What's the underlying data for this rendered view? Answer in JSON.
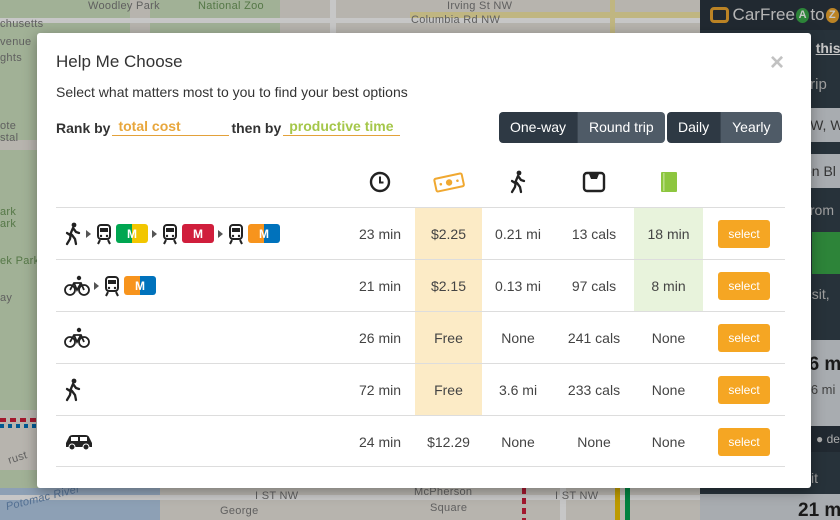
{
  "map": {
    "labels": [
      "Woodley Park",
      "National Zoo",
      "Irving St NW",
      "Columbia Rd NW",
      "chusetts",
      "venue",
      "ghts",
      "ote",
      "stal",
      "ark",
      "ark",
      "ek Park",
      "ay",
      "Potomac River",
      "rust",
      "George",
      "I ST NW",
      "I ST NW",
      "McPherson",
      "Square"
    ]
  },
  "panel": {
    "brand": {
      "text_a": "CarFree",
      "bubble_a": "A",
      "to": "to",
      "bubble_b": "Z"
    },
    "fragments": [
      "g",
      "this",
      "trip",
      "NW, W",
      "on Bl",
      "from",
      "nsit,",
      "26 m",
      "3.6 mi",
      "de",
      "sit",
      "21 m"
    ]
  },
  "modal": {
    "title": "Help Me Choose",
    "close": "×",
    "subtitle": "Select what matters most to you to find your best options",
    "rank_by_label": "Rank by",
    "rank_by_value": "total cost",
    "then_by_label": "then by",
    "then_by_value": "productive time",
    "trip_toggle": [
      {
        "label": "One-way",
        "active": true
      },
      {
        "label": "Round trip",
        "active": false
      }
    ],
    "period_toggle": [
      {
        "label": "Daily",
        "active": true
      },
      {
        "label": "Yearly",
        "active": false
      }
    ],
    "header_icons": [
      "clock-icon",
      "money-icon",
      "walking-icon",
      "scale-icon",
      "book-icon"
    ],
    "select_label": "select",
    "rows": [
      {
        "time": "23 min",
        "cost": "$2.25",
        "walk": "0.21 mi",
        "cals": "13 cals",
        "productive": "18 min",
        "badges": [
          "M",
          "M",
          "M"
        ]
      },
      {
        "time": "21 min",
        "cost": "$2.15",
        "walk": "0.13 mi",
        "cals": "97 cals",
        "productive": "8 min",
        "badges": [
          "M"
        ]
      },
      {
        "time": "26 min",
        "cost": "Free",
        "walk": "None",
        "cals": "241 cals",
        "productive": "None",
        "badges": []
      },
      {
        "time": "72 min",
        "cost": "Free",
        "walk": "3.6 mi",
        "cals": "233 cals",
        "productive": "None",
        "badges": []
      },
      {
        "time": "24 min",
        "cost": "$12.29",
        "walk": "None",
        "cals": "None",
        "productive": "None",
        "badges": []
      }
    ]
  },
  "colors": {
    "accent_orange": "#f5a623",
    "cost_highlight": "#fcebc6",
    "productive_green": "#8dc63f",
    "productive_highlight": "#e8f3dc",
    "metro_green": "#00a651",
    "metro_yellow": "#f2c600",
    "metro_red": "#d01e3c",
    "metro_orange": "#f7941d",
    "metro_blue": "#0072bc",
    "panel_dark": "#33404b"
  }
}
